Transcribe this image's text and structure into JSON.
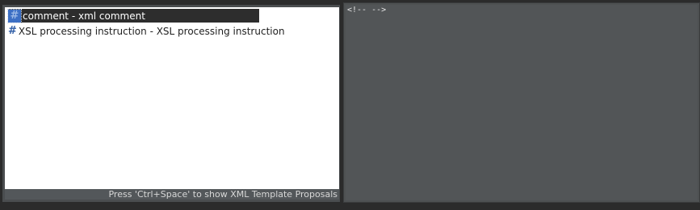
{
  "proposals": {
    "items": [
      {
        "icon": "hash-template-icon",
        "label": "comment - xml comment",
        "selected": true
      },
      {
        "icon": "hash-template-icon",
        "label": "XSL processing instruction - XSL processing instruction",
        "selected": false
      }
    ],
    "status": "Press 'Ctrl+Space' to show XML Template Proposals"
  },
  "info": {
    "preview": "<!-- -->"
  },
  "colors": {
    "selection_bg": "#2d2d2d",
    "icon_blue": "#2f5da6",
    "info_bg": "#525557"
  }
}
